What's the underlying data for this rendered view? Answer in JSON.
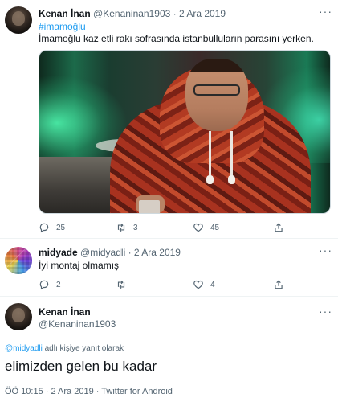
{
  "tweet1": {
    "name": "Kenan İnan",
    "handle": "@Kenaninan1903",
    "sep": "·",
    "date": "2 Ara 2019",
    "more": "···",
    "hashtag": "#imamoğlu",
    "text": "İmamoğlu kaz etli rakı sofrasında istanbulluların parasını yerken.",
    "replies": "25",
    "retweets": "3",
    "likes": "45"
  },
  "tweet2": {
    "name": "midyade",
    "handle": "@midyadli",
    "sep": "·",
    "date": "2 Ara 2019",
    "more": "···",
    "text": "İyi montaj olmamış",
    "replies": "2",
    "likes": "4"
  },
  "tweet3": {
    "name": "Kenan İnan",
    "handle": "@Kenaninan1903",
    "more": "···",
    "replying_link": "@midyadli",
    "replying_suffix": " adlı kişiye yanıt olarak",
    "text": "elimizden gelen bu kadar",
    "footer": "ÖÖ 10:15 · 2 Ara 2019 · Twitter for Android"
  },
  "colors": {
    "link": "#1d9bf0",
    "muted": "#536471",
    "text": "#0f1419",
    "divider": "#eff3f4"
  },
  "icons": [
    "more-icon",
    "reply-icon",
    "retweet-icon",
    "like-icon",
    "share-icon"
  ]
}
